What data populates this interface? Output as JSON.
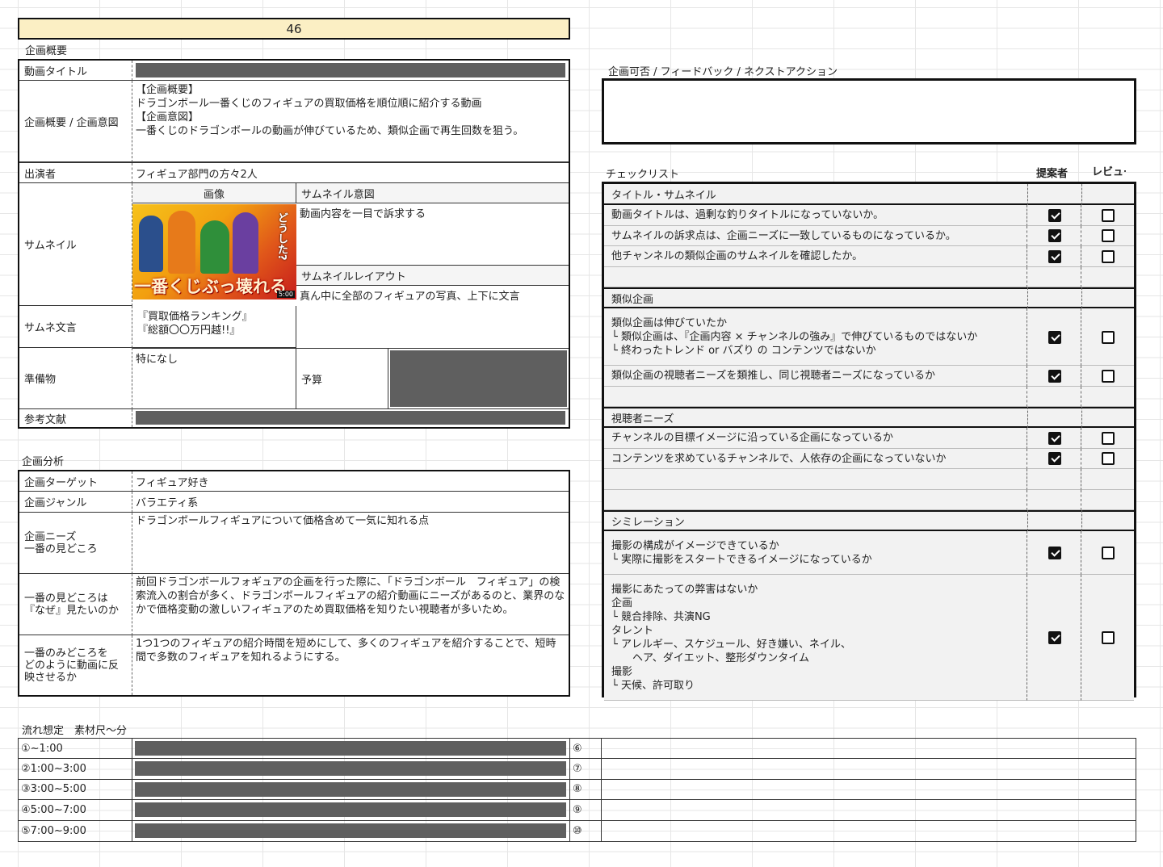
{
  "header": {
    "number": "46"
  },
  "overview": {
    "section_label": "企画概要",
    "title_label": "動画タイトル",
    "summary_label": "企画概要 / 企画意図",
    "summary_text": "【企画概要】\nドラゴンボール一番くじのフィギュアの買取価格を順位順に紹介する動画\n【企画意図】\n一番くじのドラゴンボールの動画が伸びているため、類似企画で再生回数を狙う。",
    "cast_label": "出演者",
    "cast_value": "フィギュア部門の方々2人",
    "thumbnail_label": "サムネイル",
    "image_label": "画像",
    "thumb_intent_label": "サムネイル意図",
    "thumb_intent_value": "動画内容を一目で訴求する",
    "thumb_layout_label": "サムネイルレイアウト",
    "thumb_layout_value": "真ん中に全部のフィギュアの写真、上下に文言",
    "thumb_caption": "一番くじぶっ壊れる",
    "thumb_side_text": "どうした?",
    "thumb_time": "5:00",
    "thumb_text_label": "サムネ文言",
    "thumb_text_value": "『買取価格ランキング』\n『総額〇〇万円越!!』",
    "prep_label": "準備物",
    "prep_value": "特になし",
    "budget_label": "予算",
    "ref_label": "参考文献"
  },
  "analysis": {
    "section_label": "企画分析",
    "rows": [
      {
        "label": "企画ターゲット",
        "value": "フィギュア好き"
      },
      {
        "label": "企画ジャンル",
        "value": "バラエティ系"
      },
      {
        "label": "企画ニーズ\n一番の見どころ",
        "value": "ドラゴンボールフィギュアについて価格含めて一気に知れる点"
      },
      {
        "label": "一番の見どころは\n『なぜ』見たいのか",
        "value": "前回ドラゴンボールフォギュアの企画を行った際に、「ドラゴンボール　フィギュア」の検索流入の割合が多く、ドラゴンボールフィギュアの紹介動画にニーズがあるのと、業界のなかで価格変動の激しいフィギュアのため買取価格を知りたい視聴者が多いため。"
      },
      {
        "label": "一番のみどころを\nどのように動画に反\n映させるか",
        "value": "1つ1つのフィギュアの紹介時間を短めにして、多くのフィギュアを紹介することで、短時間で多数のフィギュアを知れるようにする。"
      }
    ]
  },
  "flow": {
    "section_label": "流れ想定　素材尺〜分",
    "left": [
      "①~1:00",
      "②1:00~3:00",
      "③3:00~5:00",
      "④5:00~7:00",
      "⑤7:00~9:00"
    ],
    "right": [
      "⑥",
      "⑦",
      "⑧",
      "⑨",
      "⑩"
    ]
  },
  "feedback": {
    "label": "企画可否 / フィードバック / ネクストアクション",
    "value": ""
  },
  "checklist": {
    "label": "チェックリスト",
    "col_proposer": "提案者",
    "col_review": "レビュー",
    "sections": [
      {
        "title": "タイトル・サムネイル",
        "items": [
          {
            "text": "動画タイトルは、過剰な釣りタイトルになっていないか。",
            "proposer": true,
            "review": false
          },
          {
            "text": "サムネイルの訴求点は、企画ニーズに一致しているものになっているか。",
            "proposer": true,
            "review": false
          },
          {
            "text": "他チャンネルの類似企画のサムネイルを確認したか。",
            "proposer": true,
            "review": false
          }
        ]
      },
      {
        "title": "類似企画",
        "items": [
          {
            "text": "類似企画は伸びていたか\n└ 類似企画は、『企画内容 × チャンネルの強み』で伸びているものではないか\n└ 終わったトレンド or バズり の コンテンツではないか",
            "proposer": true,
            "review": false
          },
          {
            "text": "類似企画の視聴者ニーズを類推し、同じ視聴者ニーズになっているか",
            "proposer": true,
            "review": false
          }
        ]
      },
      {
        "title": "視聴者ニーズ",
        "items": [
          {
            "text": "チャンネルの目標イメージに沿っている企画になっているか",
            "proposer": true,
            "review": false
          },
          {
            "text": "コンテンツを求めているチャンネルで、人依存の企画になっていないか",
            "proposer": true,
            "review": false
          }
        ]
      },
      {
        "title": "シミレーション",
        "items": [
          {
            "text": "撮影の構成がイメージできているか\n└ 実際に撮影をスタートできるイメージになっているか",
            "proposer": true,
            "review": false
          },
          {
            "text": "撮影にあたっての弊害はないか\n企画\n└ 競合排除、共演NG\nタレント\n└ アレルギー、スケジュール、好き嫌い、ネイル、\n　　ヘア、ダイエット、整形ダウンタイム\n撮影\n└ 天候、許可取り",
            "proposer": true,
            "review": false
          }
        ]
      }
    ]
  },
  "colors": {
    "header_bg": "#fbefc4",
    "redacted": "#5f5f5f",
    "section_bg": "#f2f2f2"
  }
}
